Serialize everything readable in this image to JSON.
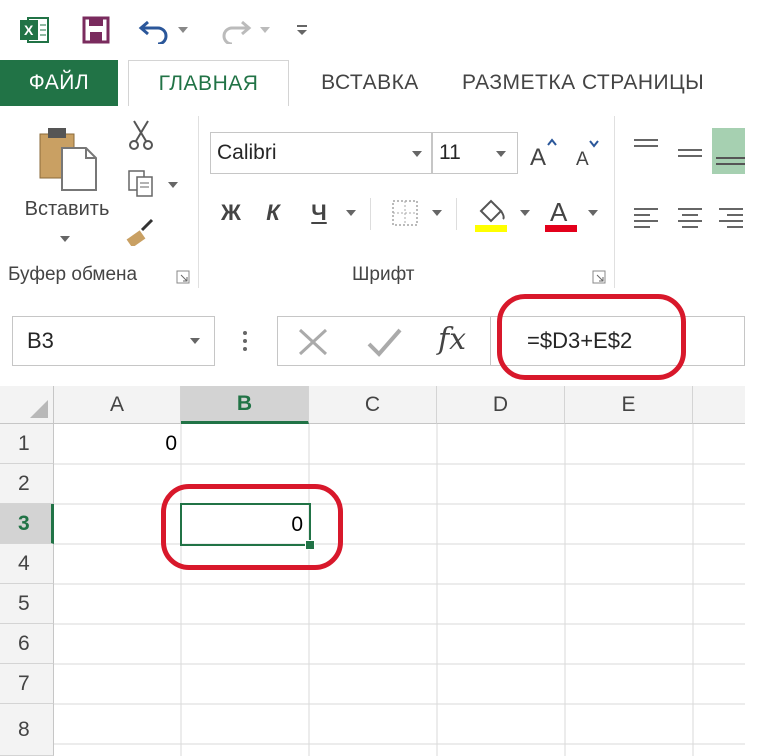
{
  "tabs": {
    "file": "ФАЙЛ",
    "home": "ГЛАВНАЯ",
    "insert": "ВСТАВКА",
    "layout": "РАЗМЕТКА СТРАНИЦЫ"
  },
  "clipboard": {
    "paste_label": "Вставить",
    "group_label": "Буфер обмена"
  },
  "font": {
    "name": "Calibri",
    "size": "11",
    "bold": "Ж",
    "italic": "К",
    "underline": "Ч",
    "group_label": "Шрифт"
  },
  "formula_bar": {
    "name_box": "B3",
    "fx": "fx",
    "formula": "=$D3+E$2"
  },
  "columns": [
    "A",
    "B",
    "C",
    "D",
    "E"
  ],
  "rows": [
    "1",
    "2",
    "3",
    "4",
    "5",
    "6",
    "7",
    "8"
  ],
  "cells": {
    "A1": "0",
    "B3": "0"
  },
  "colors": {
    "excel_green": "#217346",
    "highlight_red": "#d8182b"
  }
}
